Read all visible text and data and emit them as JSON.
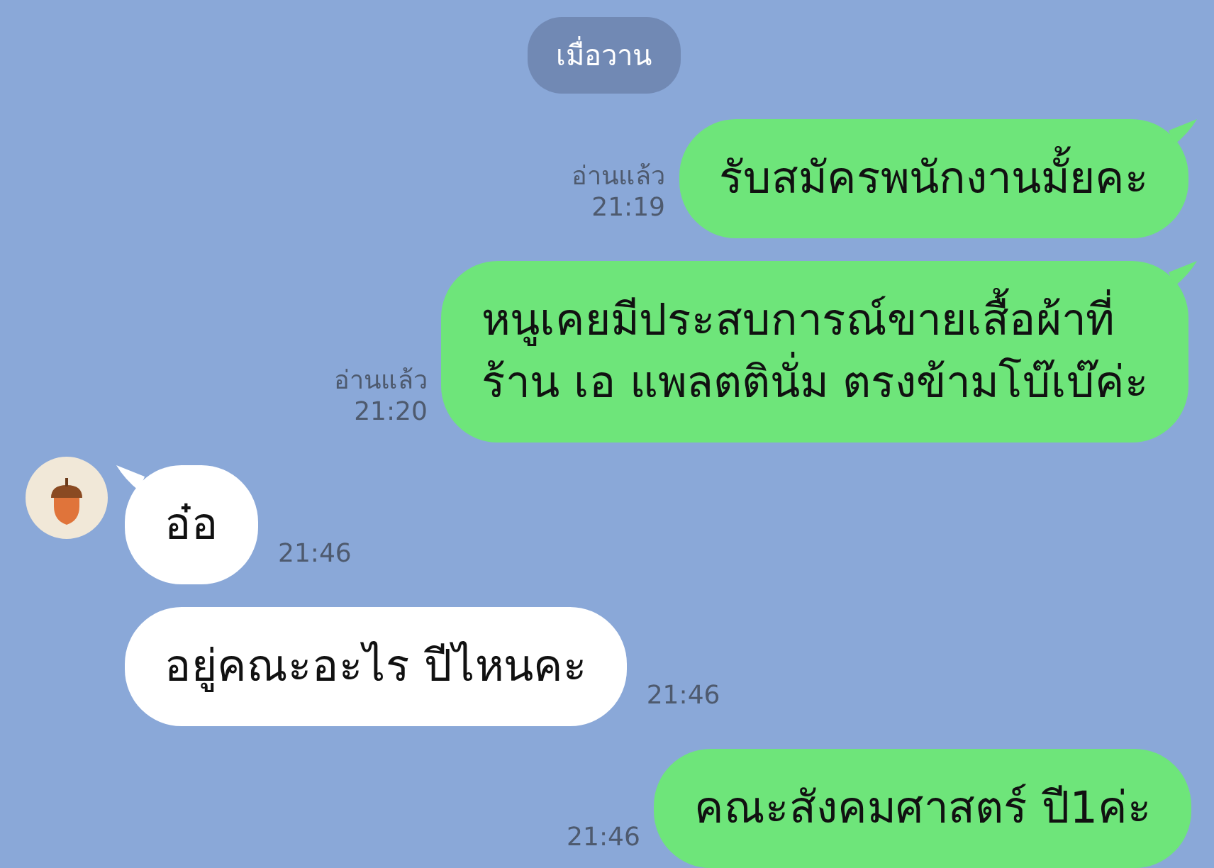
{
  "date_label": "เมื่อวาน",
  "messages": [
    {
      "kind": "outgoing",
      "lines": [
        "รับสมัครพนักงานมั้ยคะ"
      ],
      "read_label": "อ่านแล้ว",
      "time": "21:19",
      "tail": true,
      "avatar": false
    },
    {
      "kind": "outgoing",
      "lines": [
        "หนูเคยมีประสบการณ์ขายเสื้อผ้าที่",
        "ร้าน เอ แพลตตินั่ม ตรงข้ามโบ๊เบ๊ค่ะ"
      ],
      "read_label": "อ่านแล้ว",
      "time": "21:20",
      "tail": true,
      "avatar": false
    },
    {
      "kind": "incoming",
      "lines": [
        "อ๋อ"
      ],
      "time": "21:46",
      "tail": true,
      "avatar": true
    },
    {
      "kind": "incoming",
      "lines": [
        "อยู่คณะอะไร ปีไหนคะ"
      ],
      "time": "21:46",
      "tail": false,
      "avatar": false
    },
    {
      "kind": "outgoing",
      "lines": [
        "คณะสังคมศาสตร์ ปี1ค่ะ"
      ],
      "time": "21:46",
      "tail": false,
      "avatar": false
    }
  ]
}
